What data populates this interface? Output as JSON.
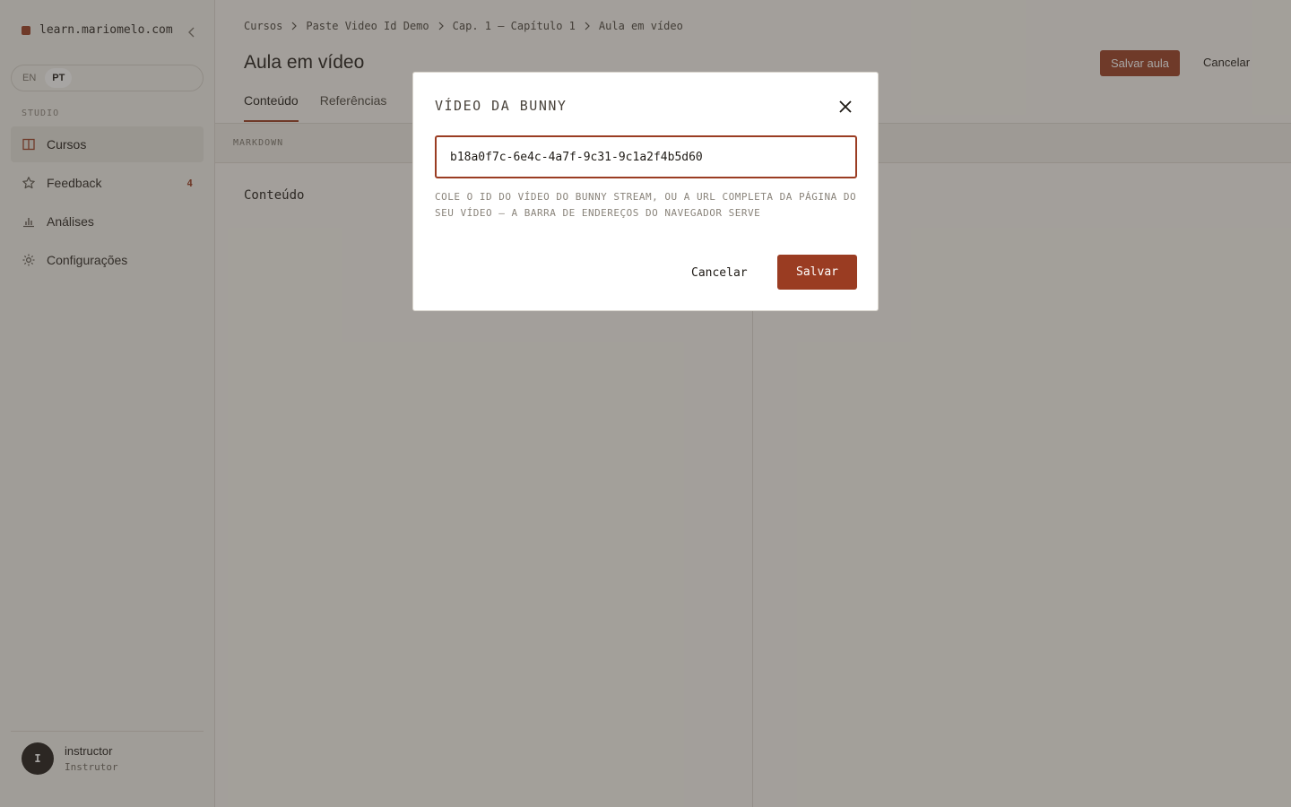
{
  "sidebar": {
    "site": "learn.mariomelo.com",
    "lang": [
      "EN",
      "PT"
    ],
    "section": "STUDIO",
    "items": [
      {
        "label": "Cursos"
      },
      {
        "label": "Feedback",
        "badge": "4"
      },
      {
        "label": "Análises"
      },
      {
        "label": "Configurações"
      }
    ],
    "user": {
      "initial": "I",
      "name": "instructor",
      "role": "Instrutor"
    }
  },
  "main": {
    "breadcrumb": [
      "Cursos",
      "Paste Video Id Demo",
      "Cap. 1 — Capítulo 1",
      "Aula em vídeo"
    ],
    "title": "Aula em vídeo",
    "save_label": "Salvar aula",
    "cancel_label": "Cancelar",
    "tabs": [
      "Conteúdo",
      "Referências"
    ],
    "markdown_label": "MARKDOWN",
    "content_label": "Conteúdo"
  },
  "modal": {
    "title": "VÍDEO DA BUNNY",
    "input_value": "b18a0f7c-6e4c-4a7f-9c31-9c1a2f4b5d60",
    "hint": "COLE O ID DO VÍDEO DO BUNNY STREAM, OU A URL COMPLETA DA PÁGINA DO SEU VÍDEO — A BARRA DE ENDEREÇOS DO NAVEGADOR SERVE",
    "cancel_label": "Cancelar",
    "save_label": "Salvar"
  },
  "colors": {
    "accent": "#9a3c22",
    "background": "#f7f5f0"
  }
}
